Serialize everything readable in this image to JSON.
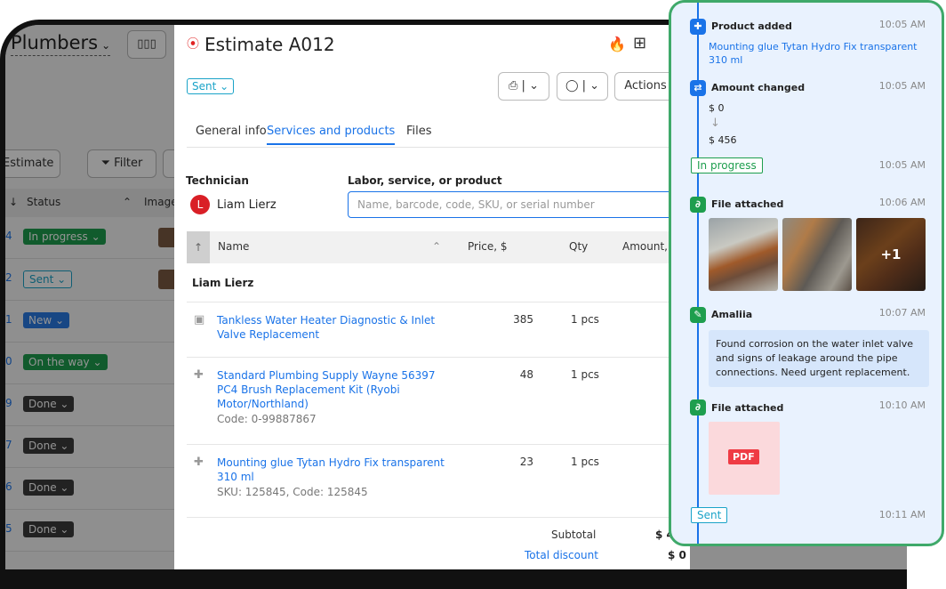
{
  "background": {
    "title": "Plumbers",
    "estimate_button": "Estimate",
    "filter_button": "Filter",
    "columns": {
      "status": "Status",
      "image": "Image"
    },
    "rows": [
      {
        "num": "4",
        "status": "In progress",
        "style": "green"
      },
      {
        "num": "2",
        "status": "Sent",
        "style": "outline"
      },
      {
        "num": "1",
        "status": "New",
        "style": "blue"
      },
      {
        "num": "0",
        "status": "On the way",
        "style": "green"
      },
      {
        "num": "9",
        "status": "Done",
        "style": "dark"
      },
      {
        "num": "7",
        "status": "Done",
        "style": "dark"
      },
      {
        "num": "6",
        "status": "Done",
        "style": "dark"
      },
      {
        "num": "5",
        "status": "Done",
        "style": "dark"
      }
    ]
  },
  "estimate": {
    "title": "Estimate A012",
    "status": "Sent",
    "actions_label": "Actions",
    "tabs": [
      "General info",
      "Services and products",
      "Files"
    ],
    "technician_label": "Technician",
    "technician_name": "Liam Lierz",
    "technician_initial": "L",
    "search_label": "Labor, service, or product",
    "search_placeholder": "Name, barcode, code, SKU, or serial number",
    "table_headers": {
      "name": "Name",
      "price": "Price, $",
      "qty": "Qty",
      "amount": "Amount, $"
    },
    "group": "Liam Lierz",
    "items": [
      {
        "name": "Tankless Water Heater Diagnostic & Inlet Valve Replacement",
        "sub": "",
        "price": "385",
        "qty": "1 pcs"
      },
      {
        "name": "Standard Plumbing Supply Wayne 56397 PC4 Brush Replacement Kit (Ryobi Motor/Northland)",
        "sub": "Code: 0-99887867",
        "price": "48",
        "qty": "1 pcs"
      },
      {
        "name": "Mounting glue Tytan Hydro Fix transparent 310 ml",
        "sub": "SKU: 125845, Code: 125845",
        "price": "23",
        "qty": "1 pcs"
      }
    ],
    "subtotal_label": "Subtotal",
    "subtotal_value": "$ 4",
    "discount_label": "Total discount",
    "discount_value": "$ 0"
  },
  "timeline": {
    "product_added": {
      "title": "Product added",
      "time": "10:05 AM",
      "item": "Mounting glue Tytan Hydro Fix transparent 310 ml"
    },
    "amount_changed": {
      "title": "Amount changed",
      "time": "10:05 AM",
      "from": "$ 0",
      "to": "$ 456"
    },
    "in_progress": {
      "label": "In progress",
      "time": "10:05 AM"
    },
    "file_attached_1": {
      "title": "File attached",
      "time": "10:06 AM",
      "more": "+1"
    },
    "comment": {
      "author": "Amaliia",
      "time": "10:07 AM",
      "text": "Found corrosion on the water inlet valve and signs of leakage around the pipe connections. Need urgent replacement."
    },
    "file_attached_2": {
      "title": "File attached",
      "time": "10:10 AM",
      "file_type": "PDF"
    },
    "sent": {
      "label": "Sent",
      "time": "10:11 AM"
    }
  },
  "icons": [
    "fire-icon",
    "qr-code-icon",
    "print-icon",
    "chat-icon",
    "puzzle-icon",
    "refresh-icon",
    "paperclip-icon",
    "note-icon",
    "filter-icon",
    "toolbox-icon"
  ],
  "colors": {
    "accent": "#1a73e8",
    "green": "#1e9e4e",
    "red": "#e02424",
    "panel_bg": "#e9f2fe",
    "panel_border": "#3fa96a"
  }
}
